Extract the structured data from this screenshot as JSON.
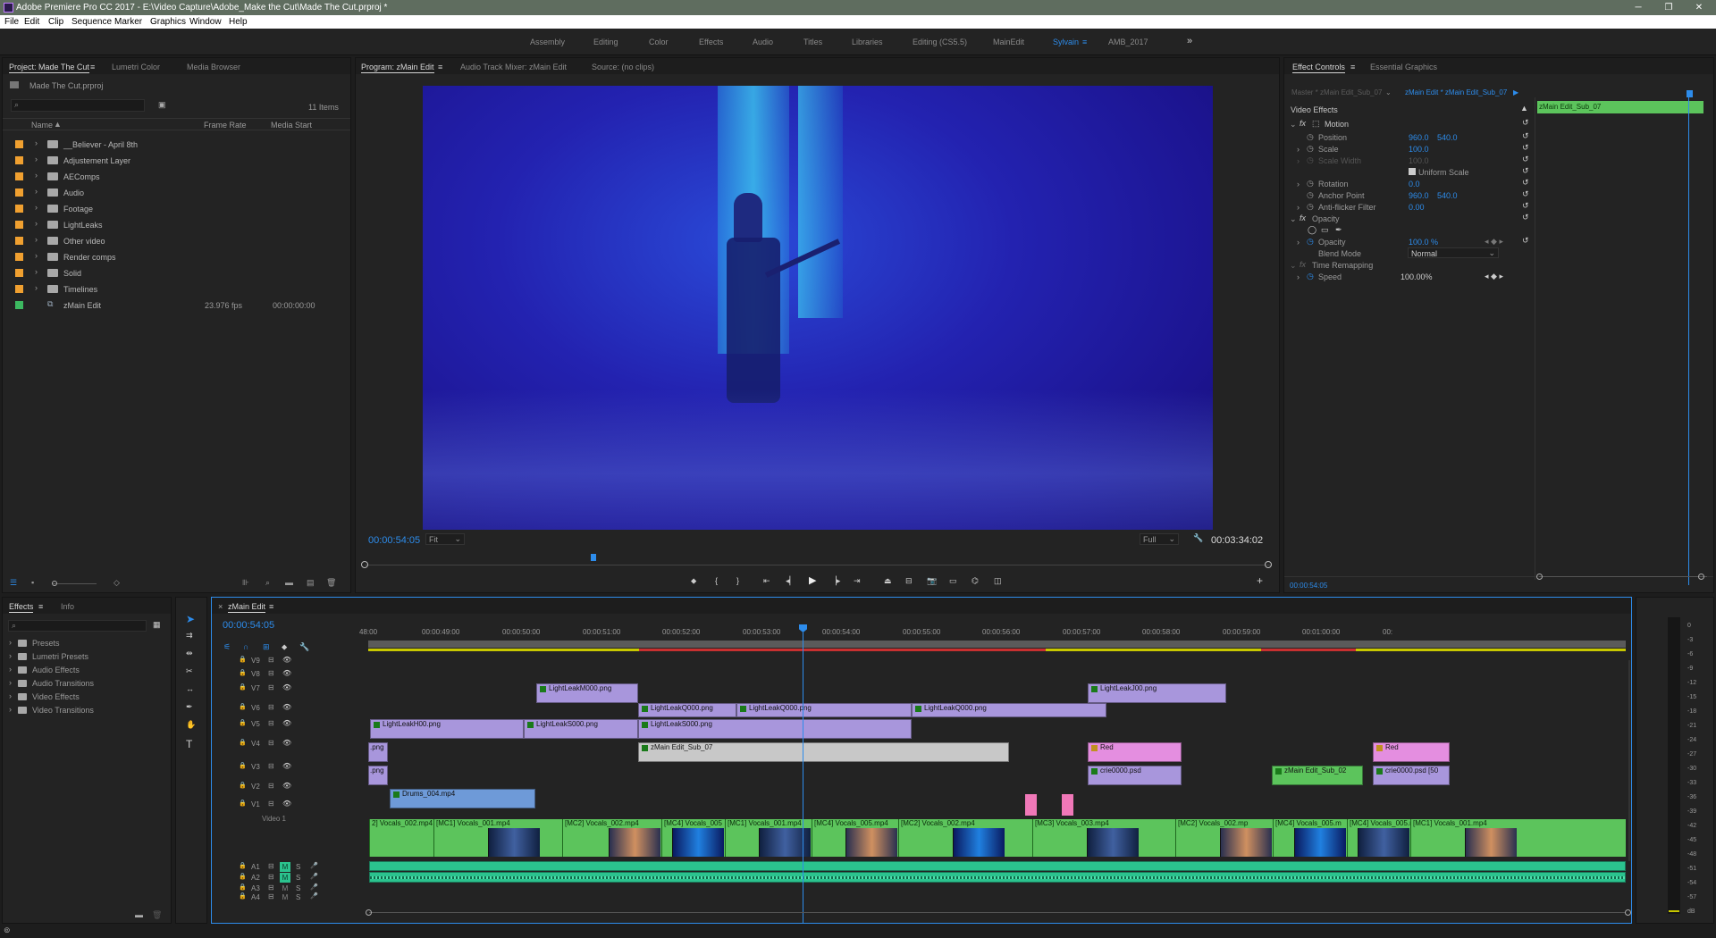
{
  "app": {
    "title": "Adobe Premiere Pro CC 2017 - E:\\Video Capture\\Adobe_Make the Cut\\Made The Cut.prproj *"
  },
  "menu": [
    "File",
    "Edit",
    "Clip",
    "Sequence",
    "Marker",
    "Graphics",
    "Window",
    "Help"
  ],
  "workspaces": [
    "Assembly",
    "Editing",
    "Color",
    "Effects",
    "Audio",
    "Titles",
    "Libraries",
    "Editing (CS5.5)",
    "MainEdit",
    "Sylvain",
    "AMB_2017"
  ],
  "workspace_active": "Sylvain",
  "workspace_more": "»",
  "project": {
    "tabs": [
      "Project: Made The Cut",
      "Lumetri Color",
      "Media Browser"
    ],
    "file": "Made The Cut.prproj",
    "items_count": "11 Items",
    "columns": [
      "Name",
      "Frame Rate",
      "Media Start"
    ],
    "rows": [
      {
        "name": "__Believer - April 8th",
        "color": "#f0a030",
        "type": "folder"
      },
      {
        "name": "Adjustement Layer",
        "color": "#f0a030",
        "type": "folder"
      },
      {
        "name": "AEComps",
        "color": "#f0a030",
        "type": "folder"
      },
      {
        "name": "Audio",
        "color": "#f0a030",
        "type": "folder"
      },
      {
        "name": "Footage",
        "color": "#f0a030",
        "type": "folder"
      },
      {
        "name": "LightLeaks",
        "color": "#f0a030",
        "type": "folder"
      },
      {
        "name": "Other video",
        "color": "#f0a030",
        "type": "folder"
      },
      {
        "name": "Render comps",
        "color": "#f0a030",
        "type": "folder"
      },
      {
        "name": "Solid",
        "color": "#f0a030",
        "type": "folder"
      },
      {
        "name": "Timelines",
        "color": "#f0a030",
        "type": "folder"
      },
      {
        "name": "zMain Edit",
        "color": "#3cb860",
        "type": "sequence",
        "fps": "23.976 fps",
        "start": "00:00:00:00"
      }
    ]
  },
  "program": {
    "tabs": [
      "Program: zMain Edit",
      "Audio Track Mixer: zMain Edit",
      "Source: (no clips)"
    ],
    "timecode": "00:00:54:05",
    "fit": "Fit",
    "quality": "Full",
    "duration": "00:03:34:02"
  },
  "effect_controls": {
    "tabs": [
      "Effect Controls",
      "Essential Graphics"
    ],
    "master": "Master * zMain Edit_Sub_07",
    "sequence": "zMain Edit * zMain Edit_Sub_07",
    "clip_label": "zMain Edit_Sub_07",
    "section": "Video Effects",
    "motion": "Motion",
    "position_label": "Position",
    "position_x": "960.0",
    "position_y": "540.0",
    "scale_label": "Scale",
    "scale": "100.0",
    "scale_width_label": "Scale Width",
    "scale_width": "100.0",
    "uniform_label": "Uniform Scale",
    "rotation_label": "Rotation",
    "rotation": "0.0",
    "anchor_label": "Anchor Point",
    "anchor_x": "960.0",
    "anchor_y": "540.0",
    "antiflicker_label": "Anti-flicker Filter",
    "antiflicker": "0.00",
    "opacity_section": "Opacity",
    "opacity_label": "Opacity",
    "opacity": "100.0 %",
    "blend_label": "Blend Mode",
    "blend": "Normal",
    "time_remap": "Time Remapping",
    "speed_label": "Speed",
    "speed": "100.00%",
    "timecode": "00:00:54:05"
  },
  "effects_panel": {
    "tabs": [
      "Effects",
      "Info"
    ],
    "items": [
      "Presets",
      "Lumetri Presets",
      "Audio Effects",
      "Audio Transitions",
      "Video Effects",
      "Video Transitions"
    ]
  },
  "timeline": {
    "tab": "zMain Edit",
    "timecode": "00:00:54:05",
    "ruler": [
      "48:00",
      "00:00:49:00",
      "00:00:50:00",
      "00:00:51:00",
      "00:00:52:00",
      "00:00:53:00",
      "00:00:54:00",
      "00:00:55:00",
      "00:00:56:00",
      "00:00:57:00",
      "00:00:58:00",
      "00:00:59:00",
      "00:01:00:00",
      "00:"
    ],
    "tracks": [
      "V9",
      "V8",
      "V7",
      "V6",
      "V5",
      "V4",
      "V3",
      "V2",
      "V1",
      "A1",
      "A2",
      "A3",
      "A4"
    ],
    "v1_name": "Video 1",
    "clips": {
      "v7a": "LightLeakM000.png",
      "v7b": "LightLeakJ00.png",
      "v6a": "LightLeakQ000.png",
      "v6b": "LightLeakQ000.png",
      "v6c": "LightLeakQ000.png",
      "v5a": "LightLeakH00.png",
      "v5b": "LightLeakS000.png",
      "v5c": "LightLeakS000.png",
      "v4a": ".png",
      "v4b": "zMain Edit_Sub_07",
      "v4c": "Red",
      "v4d": "Red",
      "v3a": ".png",
      "v3b": "crie0000.psd",
      "v3c": "zMain Edit_Sub_02",
      "v3d": "crie0000.psd [50",
      "v2a": "Drums_004.mp4",
      "v1": [
        "2] Vocals_002.mp4",
        "[MC1] Vocals_001.mp4",
        "[MC2] Vocals_002.mp4",
        "[MC4] Vocals_005",
        "[MC1] Vocals_001.mp4",
        "[MC4] Vocals_005.mp4",
        "[MC2] Vocals_002.mp4",
        "[MC3] Vocals_003.mp4",
        "[MC2] Vocals_002.mp",
        "[MC4] Vocals_005.m",
        "[MC4] Vocals_005.mp4",
        "[MC1] Vocals_001.mp4"
      ]
    }
  },
  "meter": [
    "0",
    "-3",
    "-6",
    "-9",
    "-12",
    "-15",
    "-18",
    "-21",
    "-24",
    "-27",
    "-30",
    "-33",
    "-36",
    "-39",
    "-42",
    "-45",
    "-48",
    "-51",
    "-54",
    "-57",
    "dB"
  ],
  "colors": {
    "accent": "#2d8ceb",
    "clip_purple": "#a896dc",
    "clip_green": "#5cc45c",
    "audio_green": "#2bc38e"
  }
}
